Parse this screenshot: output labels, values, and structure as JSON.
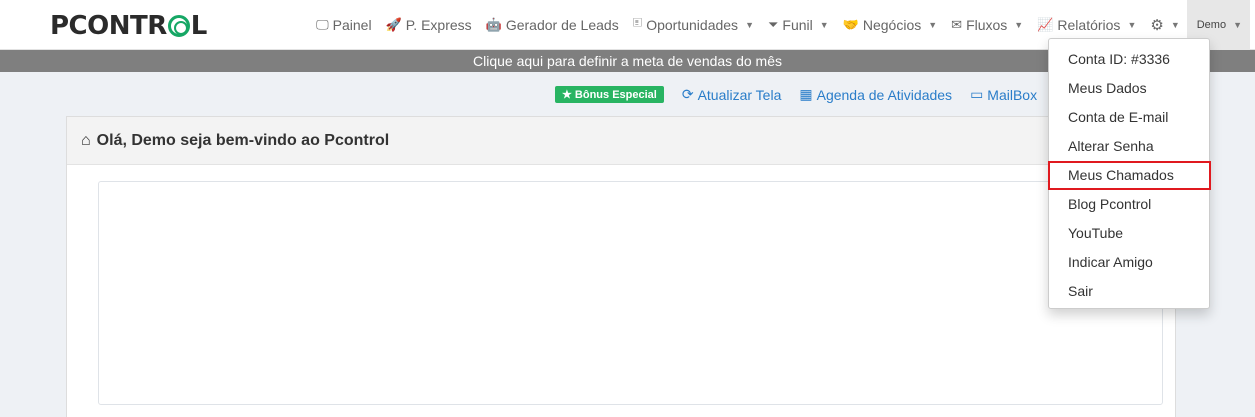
{
  "brand": {
    "logo_text_left": "PCONTR",
    "logo_text_right": "L"
  },
  "nav": [
    {
      "label": "Painel",
      "icon": "monitor-icon",
      "glyph": "🖵",
      "caret": false
    },
    {
      "label": "P. Express",
      "icon": "rocket-icon",
      "glyph": "🚀",
      "caret": false
    },
    {
      "label": "Gerador de Leads",
      "icon": "robot-icon",
      "glyph": "🤖",
      "caret": false
    },
    {
      "label": "Oportunidades",
      "icon": "contact-card-icon",
      "glyph": "🗉",
      "caret": true
    },
    {
      "label": "Funil",
      "icon": "filter-icon",
      "glyph": "⏷",
      "caret": true
    },
    {
      "label": "Negócios",
      "icon": "handshake-icon",
      "glyph": "🤝",
      "caret": true
    },
    {
      "label": "Fluxos",
      "icon": "envelope-icon",
      "glyph": "✉",
      "caret": true
    },
    {
      "label": "Relatórios",
      "icon": "line-chart-icon",
      "glyph": "📈",
      "caret": true
    }
  ],
  "settings": {
    "icon": "gear-icon",
    "glyph": "⚙"
  },
  "user_menu": {
    "label": "Demo"
  },
  "goal_bar": {
    "text": "Clique aqui para definir a meta de vendas do mês"
  },
  "actions": {
    "bonus": "Bônus Especial",
    "refresh": "Atualizar Tela",
    "agenda": "Agenda de Atividades",
    "mailbox": "MailBox"
  },
  "panel": {
    "title": "Olá, Demo seja bem-vindo ao Pcontrol"
  },
  "dropdown": {
    "items": [
      "Conta ID: #3336",
      "Meus Dados",
      "Conta de E-mail",
      "Alterar Senha",
      "Meus Chamados",
      "Blog Pcontrol",
      "YouTube",
      "Indicar Amigo",
      "Sair"
    ],
    "highlighted": "Meus Chamados",
    "highlight_color": "#e0191f"
  },
  "colors": {
    "accent_green": "#28b462",
    "link_blue": "#2a7dc9",
    "goal_bar_bg": "#7f7f7f"
  }
}
